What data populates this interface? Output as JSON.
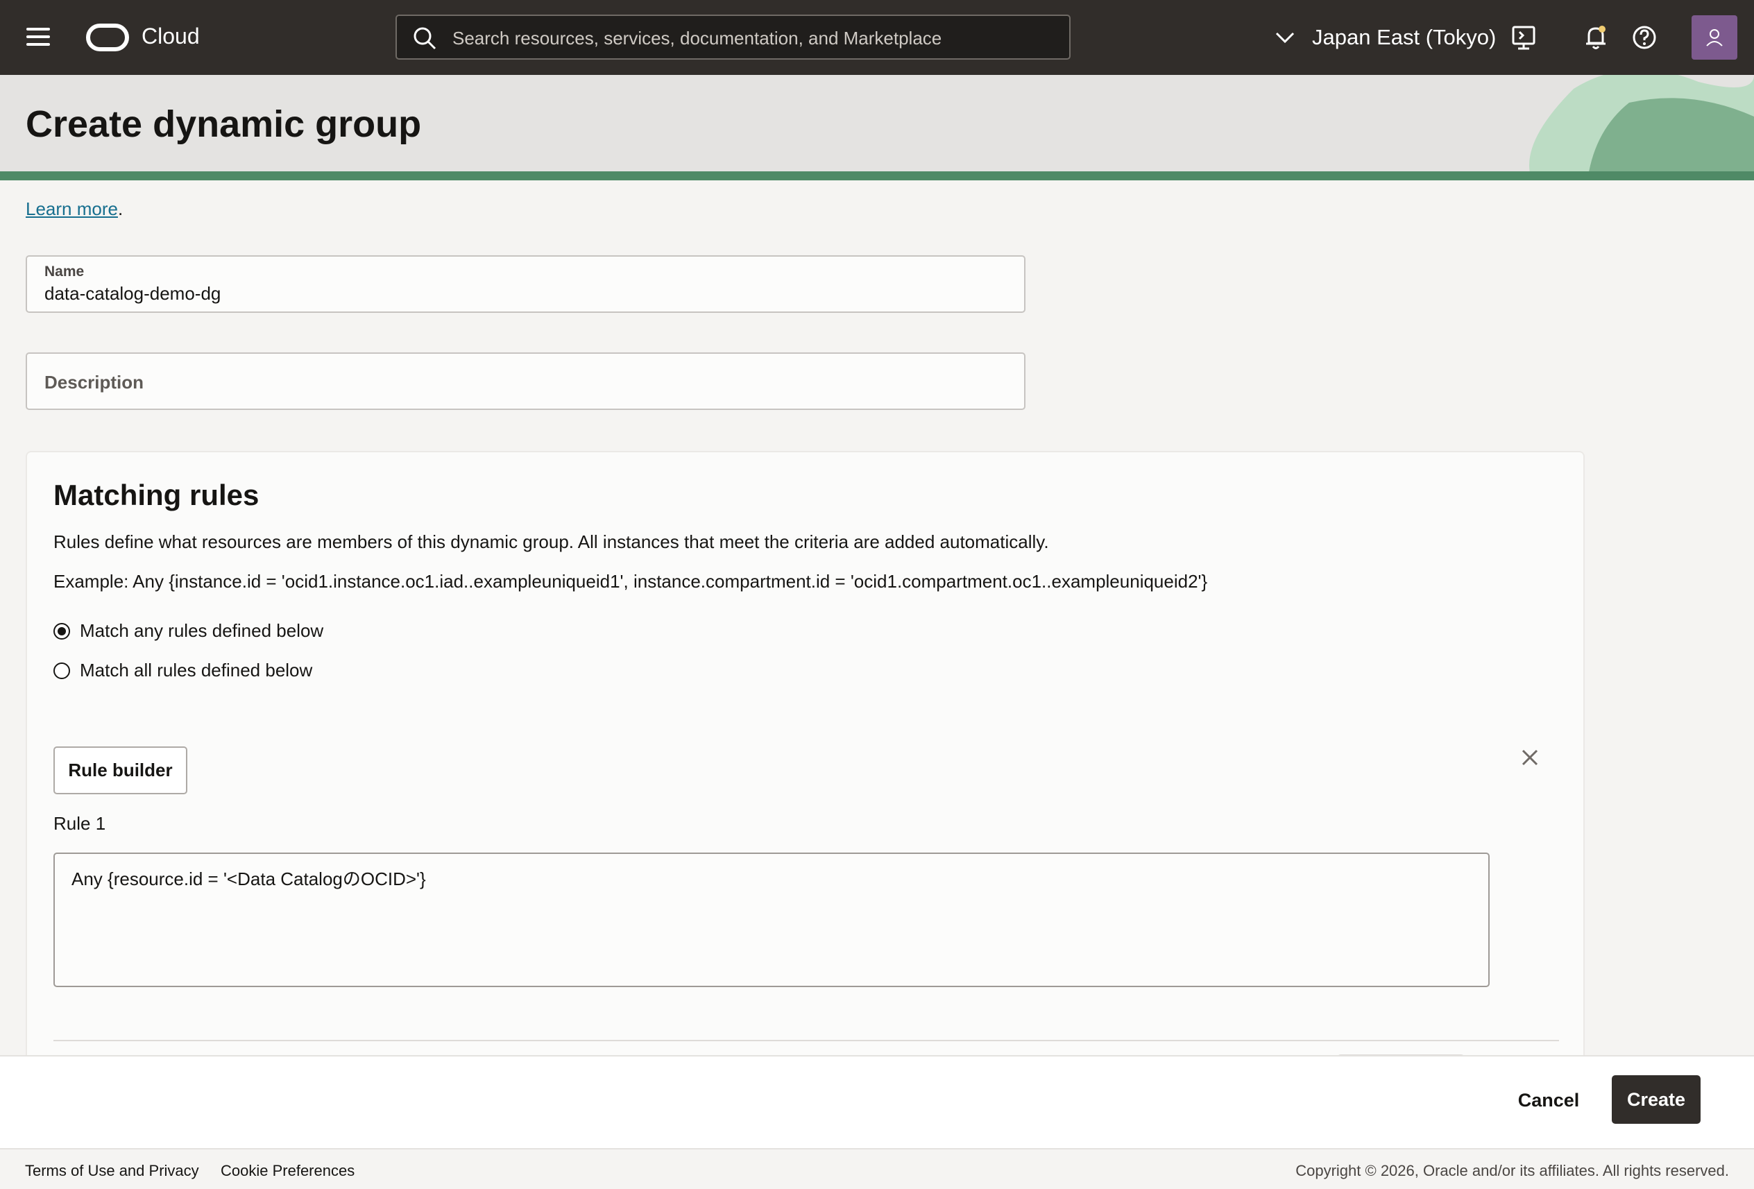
{
  "topbar": {
    "brand": "Cloud",
    "search_placeholder": "Search resources, services, documentation, and Marketplace",
    "region": "Japan East (Tokyo)",
    "icons": [
      "menu-icon",
      "oracle-logo-icon",
      "search-icon",
      "chevron-down-icon",
      "cloud-shell-icon",
      "bell-icon",
      "help-icon",
      "user-avatar-icon"
    ]
  },
  "page": {
    "title": "Create dynamic group",
    "learn_more": "Learn more",
    "learn_more_suffix": "."
  },
  "form": {
    "name_label": "Name",
    "name_value": "data-catalog-demo-dg",
    "description_placeholder": "Description"
  },
  "matching_rules": {
    "title": "Matching rules",
    "description": "Rules define what resources are members of this dynamic group. All instances that meet the criteria are added automatically.",
    "example": "Example: Any {instance.id = 'ocid1.instance.oc1.iad..exampleuniqueid1', instance.compartment.id = 'ocid1.compartment.oc1..exampleuniqueid2'}",
    "options": [
      {
        "label": "Match any rules defined below",
        "selected": true
      },
      {
        "label": "Match all rules defined below",
        "selected": false
      }
    ],
    "rule_builder_label": "Rule builder",
    "rule_label": "Rule 1",
    "rule_value": "Any {resource.id = '<Data CatalogのOCID>'}"
  },
  "actions": {
    "cancel": "Cancel",
    "create": "Create"
  },
  "footer": {
    "terms": "Terms of Use and Privacy",
    "cookies": "Cookie Preferences",
    "copyright": "Copyright © 2026, Oracle and/or its affiliates. All rights reserved."
  },
  "colors": {
    "topbar": "#312d2a",
    "accent_green": "#4f8a66",
    "link": "#176f8f",
    "primary_button": "#312d2a"
  }
}
